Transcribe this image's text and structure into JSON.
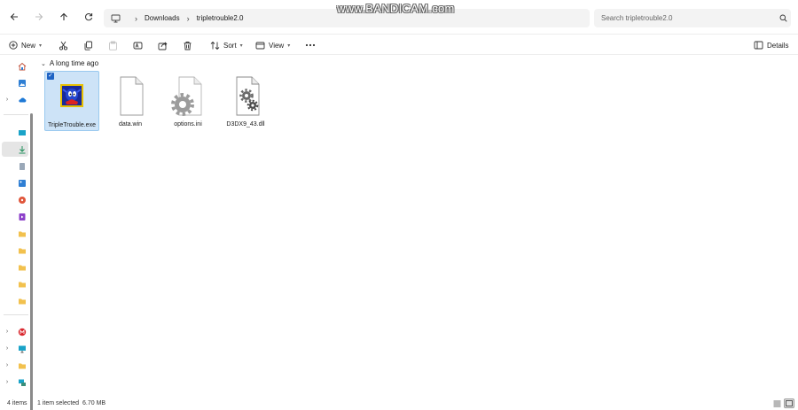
{
  "address": {
    "crumbs": [
      "Downloads",
      "tripletrouble2.0"
    ],
    "search_placeholder": "Search tripletrouble2.0"
  },
  "watermark": "www.BANDICAM.com",
  "toolbar": {
    "new_label": "New",
    "sort_label": "Sort",
    "view_label": "View",
    "details_label": "Details"
  },
  "content": {
    "group_header": "A long time ago",
    "files": [
      {
        "name": "TripleTrouble.exe",
        "icon": "app-icon",
        "selected": true
      },
      {
        "name": "data.win",
        "icon": "blank-file-icon",
        "selected": false
      },
      {
        "name": "options.ini",
        "icon": "settings-file-icon",
        "selected": false
      },
      {
        "name": "D3DX9_43.dll",
        "icon": "gear-file-icon",
        "selected": false
      }
    ]
  },
  "status": {
    "item_count": "4 items",
    "selection": "1 item selected",
    "size": "6.70 MB"
  },
  "colors": {
    "selection_bg": "#cde3f7",
    "selection_border": "#99c9ef",
    "accent": "#1e63c4"
  }
}
